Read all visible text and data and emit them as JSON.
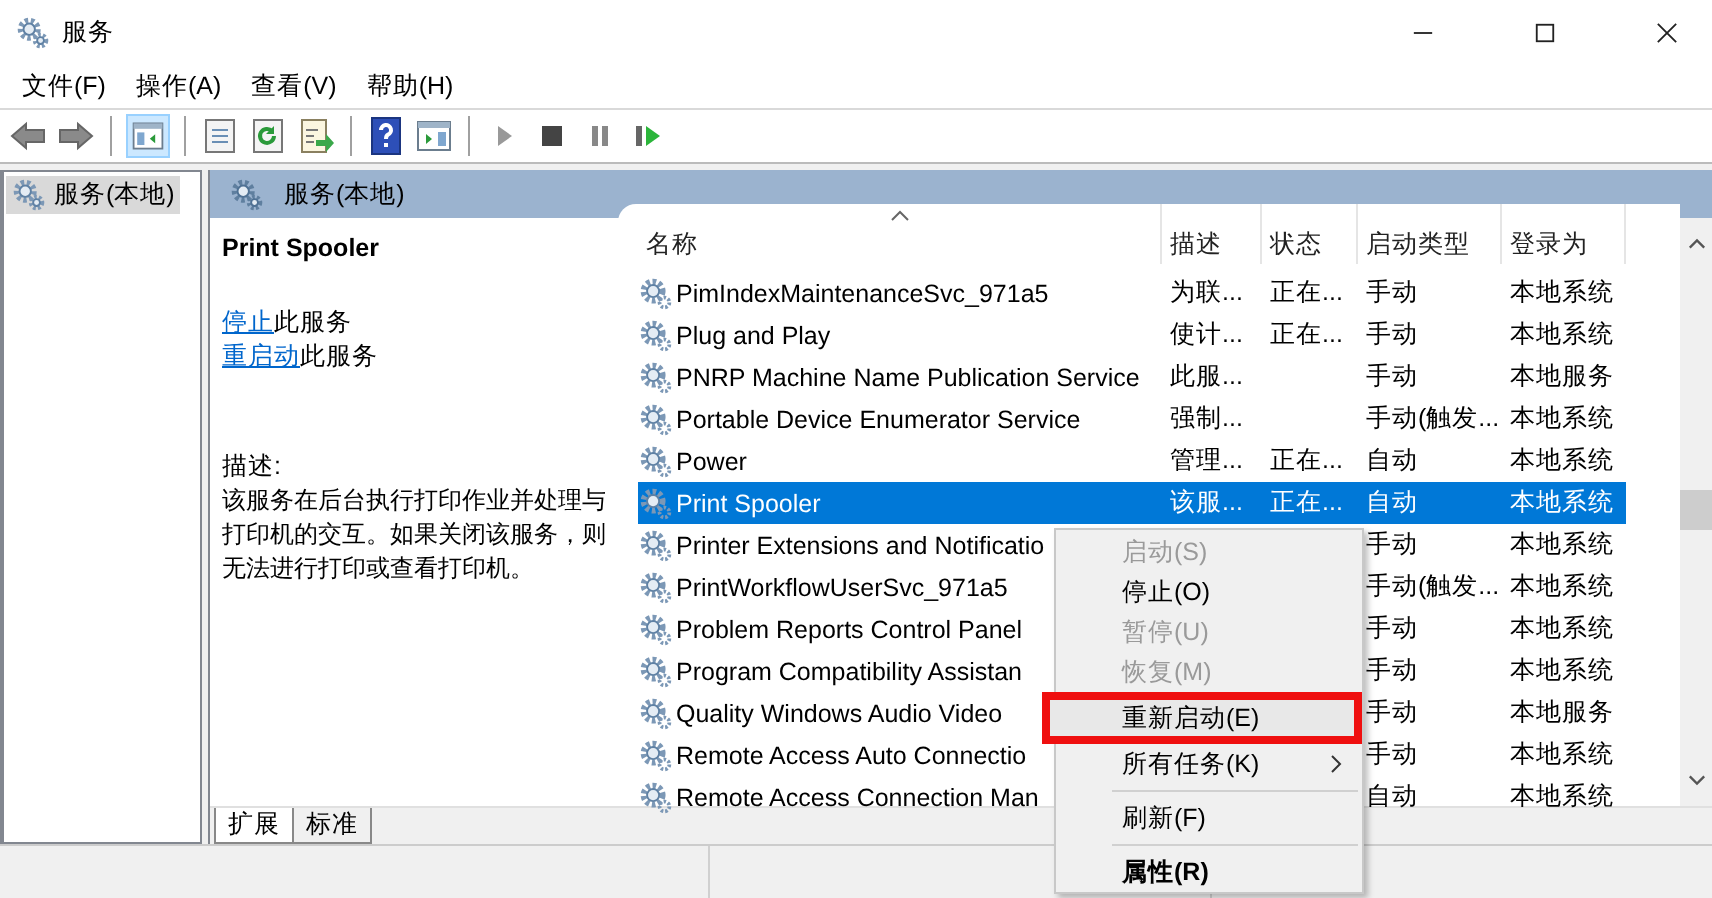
{
  "window": {
    "title": "服务"
  },
  "menu": [
    "文件(F)",
    "操作(A)",
    "查看(V)",
    "帮助(H)"
  ],
  "toolbar": {
    "tree_toggle_selected": true
  },
  "tree": [
    {
      "label": "服务(本地)",
      "selected": true
    }
  ],
  "panel_title": "服务(本地)",
  "details": {
    "name": "Print Spooler",
    "actions": [
      {
        "link": "停止",
        "text": "此服务"
      },
      {
        "link": "重启动",
        "text": "此服务"
      }
    ],
    "description_label": "描述:",
    "description": "该服务在后台执行打印作业并处理与打印机的交互。如果关闭该服务，则无法进行打印或查看打印机。"
  },
  "columns": [
    {
      "label": "名称",
      "sorted": true
    },
    {
      "label": "描述",
      "sorted": false
    },
    {
      "label": "状态",
      "sorted": false
    },
    {
      "label": "启动类型",
      "sorted": false
    },
    {
      "label": "登录为",
      "sorted": false
    }
  ],
  "rows": [
    {
      "name": "PimIndexMaintenanceSvc_971a5",
      "description": "为联...",
      "status": "正在...",
      "startup": "手动",
      "logon": "本地系统",
      "selected": false
    },
    {
      "name": "Plug and Play",
      "description": "使计...",
      "status": "正在...",
      "startup": "手动",
      "logon": "本地系统",
      "selected": false
    },
    {
      "name": "PNRP Machine Name Publication Service",
      "description": "此服...",
      "startup": "手动",
      "logon": "本地服务",
      "selected": false
    },
    {
      "name": "Portable Device Enumerator Service",
      "description": "强制...",
      "startup": "手动(触发...",
      "logon": "本地系统",
      "selected": false
    },
    {
      "name": "Power",
      "description": "管理...",
      "status": "正在...",
      "startup": "自动",
      "logon": "本地系统",
      "selected": false
    },
    {
      "name": "Print Spooler",
      "description": "该服...",
      "status": "正在...",
      "startup": "自动",
      "logon": "本地系统",
      "selected": true
    },
    {
      "name": "Printer Extensions and Notificatio",
      "startup": "手动",
      "logon": "本地系统",
      "selected": false
    },
    {
      "name": "PrintWorkflowUserSvc_971a5",
      "startup": "手动(触发...",
      "logon": "本地系统",
      "selected": false
    },
    {
      "name": "Problem Reports Control Panel",
      "startup": "手动",
      "logon": "本地系统",
      "selected": false
    },
    {
      "name": "Program Compatibility Assistan",
      "startup": "手动",
      "logon": "本地系统",
      "selected": false
    },
    {
      "name": "Quality Windows Audio Video",
      "startup": "手动",
      "logon": "本地服务",
      "selected": false
    },
    {
      "name": "Remote Access Auto Connectio",
      "startup": "手动",
      "logon": "本地系统",
      "selected": false
    },
    {
      "name": "Remote Access Connection Man",
      "startup": "自动",
      "logon": "本地系统",
      "selected": false
    }
  ],
  "context_menu": [
    {
      "kind": "item",
      "label": "启动(S)",
      "disabled": true,
      "highlighted": false,
      "submenu": false,
      "default": false
    },
    {
      "kind": "item",
      "label": "停止(O)",
      "disabled": false,
      "highlighted": false,
      "submenu": false,
      "default": false
    },
    {
      "kind": "item",
      "label": "暂停(U)",
      "disabled": true,
      "highlighted": false,
      "submenu": false,
      "default": false
    },
    {
      "kind": "item",
      "label": "恢复(M)",
      "disabled": true,
      "highlighted": false,
      "submenu": false,
      "default": false
    },
    {
      "kind": "item",
      "label": "重新启动(E)",
      "disabled": false,
      "highlighted": true,
      "submenu": false,
      "default": false
    },
    {
      "kind": "item",
      "label": "所有任务(K)",
      "disabled": false,
      "highlighted": false,
      "submenu": true,
      "default": false
    },
    {
      "kind": "separator"
    },
    {
      "kind": "item",
      "label": "刷新(F)",
      "disabled": false,
      "highlighted": false,
      "submenu": false,
      "default": false
    },
    {
      "kind": "separator"
    },
    {
      "kind": "item",
      "label": "属性(R)",
      "disabled": false,
      "highlighted": false,
      "submenu": false,
      "default": true
    }
  ],
  "tabs": [
    {
      "label": "扩展",
      "selected": true
    },
    {
      "label": "标准",
      "selected": false
    }
  ]
}
